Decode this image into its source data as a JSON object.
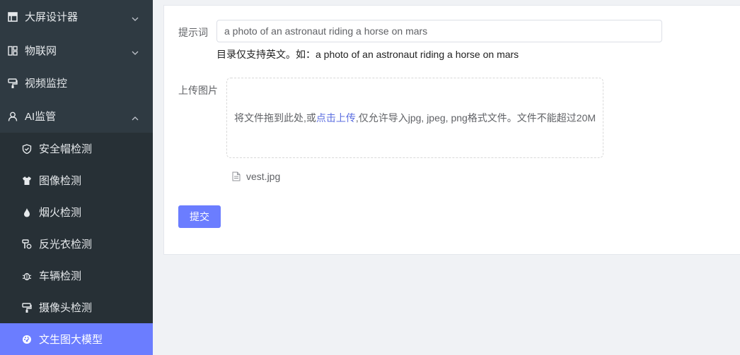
{
  "sidebar": {
    "items": [
      {
        "label": "大屏设计器",
        "icon": "table-icon",
        "expanded": false
      },
      {
        "label": "物联网",
        "icon": "grid-icon",
        "expanded": false
      },
      {
        "label": "视频监控",
        "icon": "roller-icon"
      },
      {
        "label": "AI监管",
        "icon": "user-icon",
        "expanded": true
      }
    ],
    "subitems": [
      {
        "label": "安全帽检测",
        "icon": "shield-icon"
      },
      {
        "label": "图像检测",
        "icon": "shirt-icon"
      },
      {
        "label": "烟火检测",
        "icon": "flame-icon"
      },
      {
        "label": "反光衣检测",
        "icon": "brush-icon"
      },
      {
        "label": "车辆检测",
        "icon": "bug-icon"
      },
      {
        "label": "摄像头检测",
        "icon": "roller-icon"
      },
      {
        "label": "文生图大模型",
        "icon": "dashboard-icon",
        "active": true
      }
    ]
  },
  "form": {
    "prompt_label": "提示词",
    "prompt_value": "a photo of an astronaut riding a horse on mars",
    "prompt_tip": "目录仅支持英文。如：a photo of an astronaut riding a horse on mars",
    "upload_label": "上传图片",
    "upload_text_before": "将文件拖到此处,或",
    "upload_link": "点击上传",
    "upload_text_after": ",仅允许导入jpg, jpeg, png格式文件。文件不能超过20M",
    "file_name": "vest.jpg",
    "submit_label": "提交"
  },
  "colors": {
    "sidebar_bg": "#2f3a42",
    "accent": "#6b7dff",
    "link": "#5b6ee0"
  }
}
